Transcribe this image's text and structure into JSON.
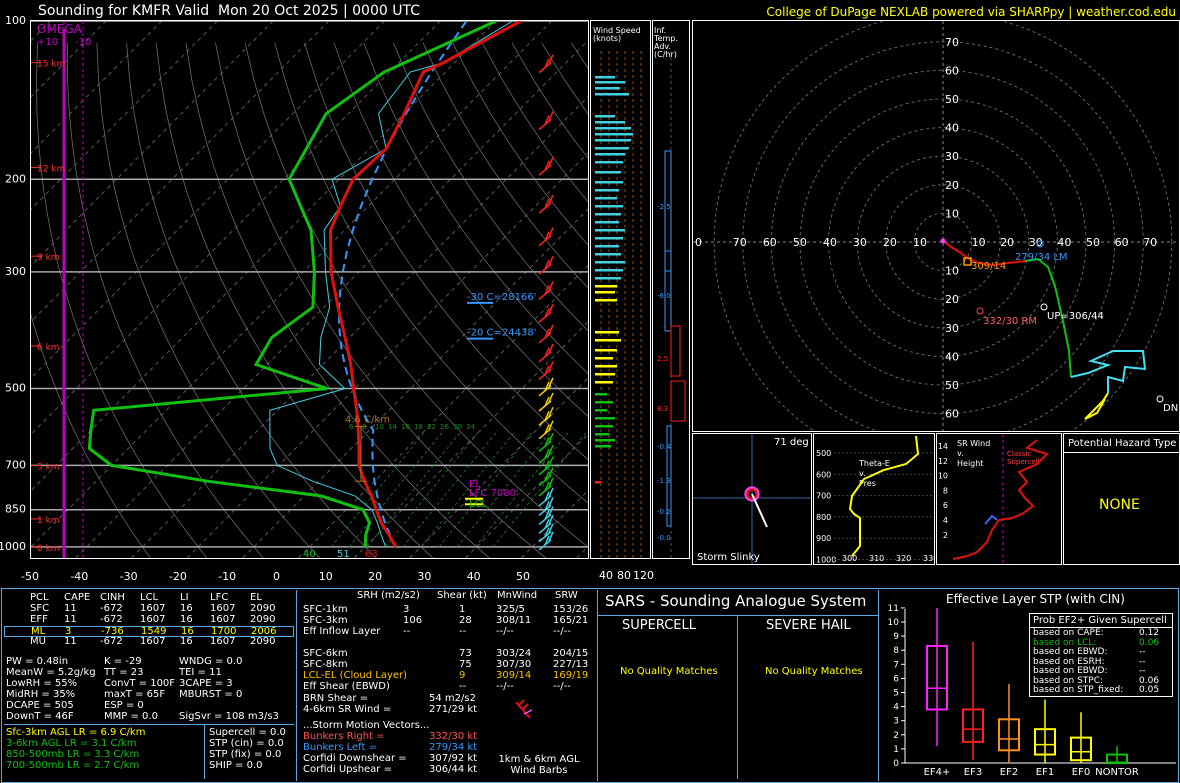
{
  "header": {
    "title": "Sounding for KMFR Valid  Mon 20 Oct 2025 | 0000 UTC",
    "credit": "College of DuPage NEXLAB powered via SHARPpy | weather.cod.edu"
  },
  "chart_data": [
    {
      "type": "line",
      "name": "skew-T",
      "pressure_ticks": [
        "100",
        "200",
        "300",
        "500",
        "700",
        "850",
        "1000"
      ],
      "temp_ticks": [
        "-50",
        "-40",
        "-30",
        "-20",
        "-10",
        "0",
        "10",
        "20",
        "30",
        "40",
        "50"
      ],
      "omega": {
        "label": "OMEGA",
        "range": [
          "+10",
          "-10"
        ]
      },
      "height_labels": [
        "15 km",
        "12 km",
        "9 km",
        "6 km",
        "3 km",
        "1 km",
        "0 km"
      ],
      "temperature_profile": [
        [
          1000,
          15.5
        ],
        [
          950,
          12.2
        ],
        [
          900,
          8.6
        ],
        [
          850,
          5.4
        ],
        [
          800,
          2.1
        ],
        [
          750,
          -1.8
        ],
        [
          700,
          -5.6
        ],
        [
          650,
          -8.6
        ],
        [
          600,
          -12.0
        ],
        [
          550,
          -15.8
        ],
        [
          500,
          -20.2
        ],
        [
          450,
          -25.0
        ],
        [
          400,
          -30.8
        ],
        [
          350,
          -37.5
        ],
        [
          300,
          -45.0
        ],
        [
          250,
          -52.5
        ],
        [
          225,
          -55.0
        ],
        [
          200,
          -57.5
        ],
        [
          175,
          -57.0
        ],
        [
          150,
          -60.0
        ],
        [
          125,
          -64.0
        ],
        [
          120,
          -62.0
        ],
        [
          100,
          -55.5
        ]
      ],
      "dewpoint_profile": [
        [
          1000,
          10.0
        ],
        [
          950,
          8.0
        ],
        [
          900,
          6.5
        ],
        [
          850,
          3.0
        ],
        [
          800,
          -7.0
        ],
        [
          750,
          -30.0
        ],
        [
          700,
          -50.0
        ],
        [
          650,
          -57.0
        ],
        [
          600,
          -60.0
        ],
        [
          550,
          -63.0
        ],
        [
          500,
          -25.0
        ],
        [
          450,
          -42.0
        ],
        [
          400,
          -44.0
        ],
        [
          350,
          -42.0
        ],
        [
          300,
          -48.0
        ],
        [
          250,
          -56.0
        ],
        [
          200,
          -69.0
        ],
        [
          150,
          -74.0
        ],
        [
          125,
          -71.0
        ],
        [
          100,
          -60.0
        ]
      ],
      "annotations": {
        "lapse_rate": "4.6 C/km",
        "lines": [
          "-30 C=28166'",
          "-20 C=24438'"
        ],
        "el": "EL",
        "lfc": "LFC 7080'",
        "lcl": "LCL",
        "sfc_t": "63",
        "sfc_td": "51",
        "sfc_wb": "40"
      },
      "dcape_labels": [
        "6",
        "8",
        "10",
        "14",
        "16",
        "18",
        "22",
        "26",
        "30",
        "34"
      ]
    },
    {
      "type": "bar",
      "name": "wind-speed",
      "title": "Wind Speed (knots)",
      "axis_labels": [
        "40",
        "80",
        "120"
      ]
    },
    {
      "type": "line",
      "name": "inferred-temp-advection",
      "title": "Inf. Temp. Adv. (C/hr)",
      "labels": [
        "-2.5",
        "-6.0",
        "2.5",
        "8.3",
        "-0.4",
        "-1.3",
        "-0.2",
        "-0.0"
      ]
    },
    {
      "type": "scatter",
      "name": "hodograph",
      "rings": [
        "10",
        "20",
        "30",
        "40",
        "50",
        "60",
        "70"
      ],
      "x_labels": [
        "0",
        "70",
        "60",
        "50",
        "40",
        "30",
        "20",
        "10",
        "10",
        "20",
        "30",
        "40",
        "50",
        "60",
        "70"
      ],
      "labels": {
        "lm": "279/34 LM",
        "rm": "332/30 RM",
        "up": "UP=306/44",
        "mean": "309/14",
        "dn": "DN"
      }
    },
    {
      "type": "bar",
      "name": "effective-layer-stp",
      "title": "Effective Layer STP (with CIN)",
      "categories": [
        "EF4+",
        "EF3",
        "EF2",
        "EF1",
        "EF0",
        "NONTOR"
      ],
      "y_ticks": [
        "0",
        "1",
        "2",
        "3",
        "4",
        "5",
        "6",
        "7",
        "8",
        "9",
        "10",
        "11"
      ],
      "box": [
        {
          "min": 1.2,
          "q1": 3.8,
          "median": 5.3,
          "q3": 8.3,
          "max": 11.0
        },
        {
          "min": 0.2,
          "q1": 1.5,
          "median": 2.4,
          "q3": 3.8,
          "max": 8.6
        },
        {
          "min": 0.0,
          "q1": 0.9,
          "median": 1.7,
          "q3": 3.1,
          "max": 5.6
        },
        {
          "min": 0.0,
          "q1": 0.6,
          "median": 1.3,
          "q3": 2.4,
          "max": 4.5
        },
        {
          "min": 0.0,
          "q1": 0.2,
          "median": 0.8,
          "q3": 1.8,
          "max": 3.6
        },
        {
          "min": 0.0,
          "q1": 0.0,
          "median": 0.05,
          "q3": 0.6,
          "max": 1.2
        }
      ],
      "prob_panel": {
        "title": "Prob EF2+ Given Supercell",
        "rows": [
          [
            "based on CAPE:",
            "0.12"
          ],
          [
            "based on LCL:",
            "0.06"
          ],
          [
            "based on EBWD:",
            "--"
          ],
          [
            "based on ESRH:",
            "--"
          ],
          [
            "based on EBWD:",
            "--"
          ],
          [
            "based on STPC:",
            "0.06"
          ],
          [
            "based on STP_fixed:",
            "0.05"
          ]
        ]
      }
    }
  ],
  "small_panels": {
    "storm_slinky": {
      "title": "Storm Slinky",
      "deg": "71 deg"
    },
    "theta_e": {
      "title": "Theta-E v. Pres",
      "y": [
        "500",
        "600",
        "700",
        "800",
        "900",
        "1000"
      ],
      "x": [
        "300",
        "310",
        "320",
        "330"
      ]
    },
    "sr_wind": {
      "title": "SR Wind v. Height",
      "y": [
        "14",
        "12",
        "10",
        "8",
        "6",
        "4",
        "2"
      ],
      "tag": "Classic Supercell"
    },
    "hazard": {
      "title": "Potential Hazard Type",
      "value": "NONE"
    }
  },
  "parcels": {
    "headers": [
      "PCL",
      "CAPE",
      "CINH",
      "LCL",
      "LI",
      "LFC",
      "EL"
    ],
    "rows": [
      [
        "SFC",
        "11",
        "-672",
        "1607",
        "16",
        "1607",
        "2090"
      ],
      [
        "EFF",
        "11",
        "-672",
        "1607",
        "16",
        "1607",
        "2090"
      ],
      [
        "ML",
        "3",
        "-736",
        "1549",
        "16",
        "1700",
        "2006"
      ],
      [
        "MU",
        "11",
        "-672",
        "1607",
        "16",
        "1607",
        "2090"
      ]
    ],
    "indices_left": [
      "PW = 0.48in",
      "MeanW = 5.2g/kg",
      "LowRH = 55%",
      "MidRH = 35%",
      "DCAPE = 505",
      "DownT = 46F"
    ],
    "indices_mid": [
      "K = -29",
      "TT = 23",
      "ConvT = 100F",
      "maxT = 65F",
      "ESP = 0",
      "MMP = 0.0"
    ],
    "indices_right": [
      "WNDG = 0.0",
      "TEI = 11",
      "3CAPE = 3",
      "MBURST = 0",
      "",
      "SigSvr = 108 m3/s3"
    ],
    "lapse": [
      "Sfc-3km AGL LR = 6.9 C/km",
      "3-6km AGL LR = 3.1 C/km",
      "850-500mb LR = 3.3 C/km",
      "700-500mb LR = 2.7 C/km"
    ],
    "composite": [
      "Supercell = 0.0",
      "STP (cin) = 0.0",
      "STP (fix) = 0.0",
      "SHIP = 0.0"
    ]
  },
  "kinematics": {
    "headers": [
      "SRH (m2/s2)",
      "Shear (kt)",
      "MnWind",
      "SRW"
    ],
    "rows": [
      [
        "SFC-1km",
        "3",
        "1",
        "325/5",
        "153/26"
      ],
      [
        "SFC-3km",
        "106",
        "28",
        "308/11",
        "165/21"
      ],
      [
        "Eff Inflow Layer",
        "--",
        "--",
        "--/--",
        "--/--"
      ],
      [
        "",
        "",
        "",
        "",
        ""
      ],
      [
        "SFC-6km",
        "73",
        "303/24",
        "204/15",
        ""
      ],
      [
        "SFC-8km",
        "75",
        "307/30",
        "227/13",
        ""
      ],
      [
        "LCL-EL (Cloud Layer)",
        "9",
        "309/14",
        "169/19",
        ""
      ],
      [
        "Eff Shear (EBWD)",
        "--",
        "--/--",
        "--/--",
        ""
      ]
    ],
    "brn": "BRN Shear =",
    "brn_val": "54 m2/s2",
    "sr46": "4-6km SR Wind =",
    "sr46_val": "271/29 kt",
    "motion_title": "...Storm Motion Vectors...",
    "motion": [
      [
        "Bunkers Right =",
        "332/30 kt"
      ],
      [
        "Bunkers Left =",
        "279/34 kt"
      ],
      [
        "Corfidi Downshear =",
        "307/92 kt"
      ],
      [
        "Corfidi Upshear =",
        "306/44 kt"
      ]
    ],
    "barbs_label": "1km & 6km AGL Wind Barbs"
  },
  "sars": {
    "title": "SARS - Sounding Analogue System",
    "supercell": "SUPERCELL",
    "hail": "SEVERE HAIL",
    "supercell_result": "No Quality Matches",
    "hail_result": "No Quality Matches"
  }
}
